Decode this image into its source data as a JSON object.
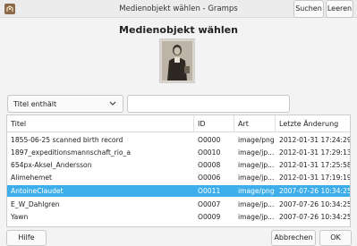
{
  "window": {
    "title": "Medienobjekt wählen - Gramps",
    "controls": [
      "˅",
      "^",
      "×"
    ]
  },
  "dialog": {
    "heading": "Medienobjekt wählen"
  },
  "filter": {
    "selected": "Titel enthält",
    "search_value": "",
    "search_button": "Suchen",
    "clear_button": "Leeren"
  },
  "table": {
    "columns": [
      "Titel",
      "ID",
      "Art",
      "Letzte Änderung"
    ],
    "rows": [
      {
        "title": "1855-06-25 scanned birth record",
        "id": "O0000",
        "type": "image/png",
        "modified": "2012-01-31 17:24:29",
        "selected": false
      },
      {
        "title": "1897_expeditionsmannschaft_rio_a",
        "id": "O0010",
        "type": "image/jp...",
        "modified": "2012-01-31 17:29:13",
        "selected": false
      },
      {
        "title": "654px-Aksel_Andersson",
        "id": "O0008",
        "type": "image/jp...",
        "modified": "2012-01-31 17:25:58",
        "selected": false
      },
      {
        "title": "Alimehemet",
        "id": "O0006",
        "type": "image/jp...",
        "modified": "2012-01-31 17:19:19",
        "selected": false
      },
      {
        "title": "AntoineClaudet",
        "id": "O0011",
        "type": "image/png",
        "modified": "2007-07-26 10:34:25",
        "selected": true
      },
      {
        "title": "E_W_Dahlgren",
        "id": "O0007",
        "type": "image/jp...",
        "modified": "2007-07-26 10:34:25",
        "selected": false
      },
      {
        "title": "Yawn",
        "id": "O0009",
        "type": "image/jp...",
        "modified": "2007-07-26 10:34:25",
        "selected": false
      }
    ]
  },
  "footer": {
    "help": "Hilfe",
    "cancel": "Abbrechen",
    "ok": "OK"
  },
  "colors": {
    "selection": "#3daee9"
  }
}
